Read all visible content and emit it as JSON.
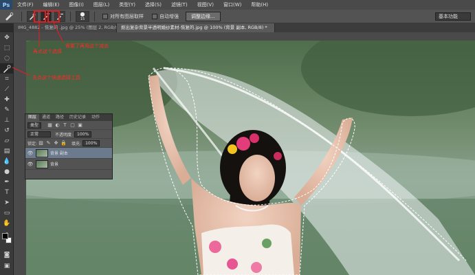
{
  "menu": {
    "logo": "Ps",
    "items": [
      "文件(F)",
      "编辑(E)",
      "图像(I)",
      "图层(L)",
      "类型(Y)",
      "选择(S)",
      "滤镜(T)",
      "视图(V)",
      "窗口(W)",
      "帮助(H)"
    ]
  },
  "options": {
    "brush_size": "15",
    "sample_all_layers": "对所有图层取样",
    "auto_enhance": "自动增强",
    "refine_edge": "调整边缘...",
    "workspace": "基本功能"
  },
  "tabs": [
    {
      "label": "IMG_4882 - 恢复的 .jpg @ 25% (图层 2, RGB/8) *"
    },
    {
      "label": "抠出复杂背景半透明婚纱素材-恢复的.jpg @ 100% (背景 副本, RGB/8) *"
    }
  ],
  "annotations": {
    "add_tool": "再点这个选择",
    "subtract_tool": "需要了再用这个减去",
    "quick_select": "先点这个快速选择工具"
  },
  "layers_panel": {
    "tabs": [
      "图层",
      "通道",
      "路径",
      "历史记录",
      "动作"
    ],
    "kind_filter": "类型",
    "blend_mode": "正常",
    "opacity_label": "不透明度:",
    "opacity_value": "100%",
    "lock_label": "锁定:",
    "fill_label": "填充:",
    "fill_value": "100%",
    "layers": [
      {
        "name": "背景 副本",
        "selected": true
      },
      {
        "name": "背景",
        "selected": false
      }
    ]
  },
  "colors": {
    "accent_red": "#e02020",
    "layer_selected": "#6c7a8e"
  }
}
